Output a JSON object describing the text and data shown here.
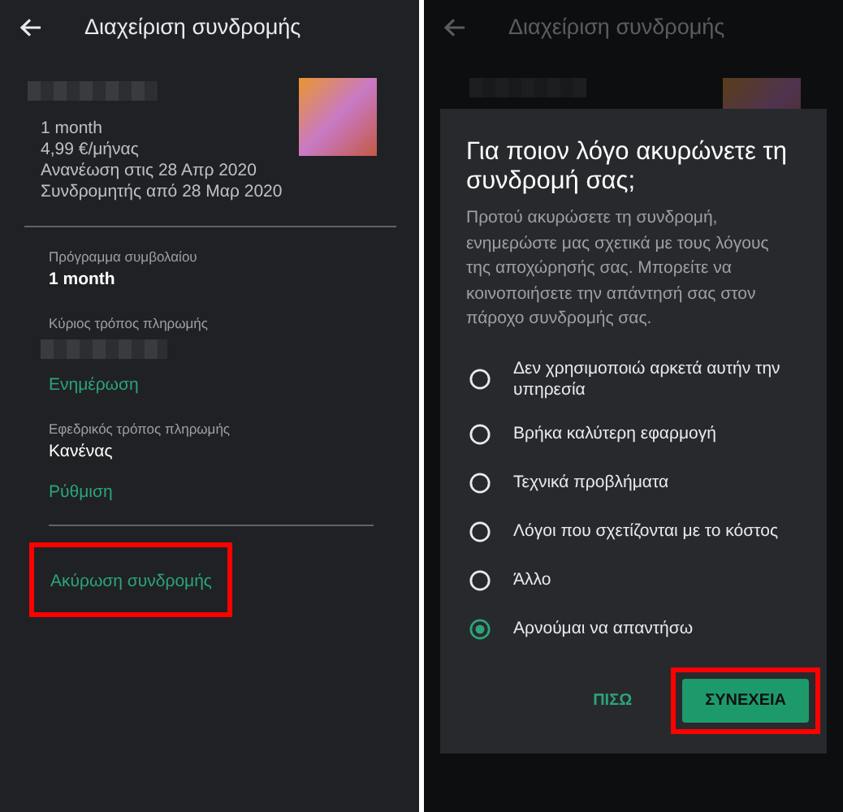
{
  "left_screen": {
    "title": "Διαχείριση συνδρομής",
    "details": [
      "1 month",
      "4,99 €/μήνας",
      "Ανανέωση στις 28 Απρ 2020",
      "Συνδρομητής από 28 Μαρ 2020"
    ],
    "sections": [
      {
        "label": "Πρόγραμμα συμβολαίου",
        "value": "1 month"
      },
      {
        "label": "Κύριος τρόπος πληρωμής",
        "hidden_value": true,
        "action": "Ενημέρωση"
      },
      {
        "label": "Εφεδρικός τρόπος πληρωμής",
        "value": "Κανένας",
        "action": "Ρύθμιση"
      }
    ],
    "cancel_link": {
      "label": "Ακύρωση συνδρομής",
      "highlighted": true
    }
  },
  "right_screen": {
    "title": "Διαχείριση συνδρομής",
    "dialog": {
      "title": "Για ποιον λόγο ακυρώνετε τη συνδρομή σας;",
      "description": "Προτού ακυρώσετε τη συνδρομή, ενημερώστε μας σχετικά με τους λόγους της αποχώρησής σας. Μπορείτε να κοινοποιήσετε την απάντησή σας στον πάροχο συνδρομής σας.",
      "options": [
        {
          "label": "Δεν χρησιμοποιώ αρκετά αυτήν την υπηρεσία",
          "selected": false
        },
        {
          "label": "Βρήκα καλύτερη εφαρμογή",
          "selected": false
        },
        {
          "label": "Τεχνικά προβλήματα",
          "selected": false
        },
        {
          "label": "Λόγοι που σχετίζονται με το κόστος",
          "selected": false
        },
        {
          "label": "Άλλο",
          "selected": false
        },
        {
          "label": "Αρνούμαι να απαντήσω",
          "selected": true
        }
      ],
      "buttons": [
        {
          "label": "ΠΙΣΩ",
          "kind": "text",
          "highlighted": false
        },
        {
          "label": "ΣΥΝΕΧΕΙΑ",
          "kind": "filled",
          "highlighted": true
        }
      ]
    }
  }
}
